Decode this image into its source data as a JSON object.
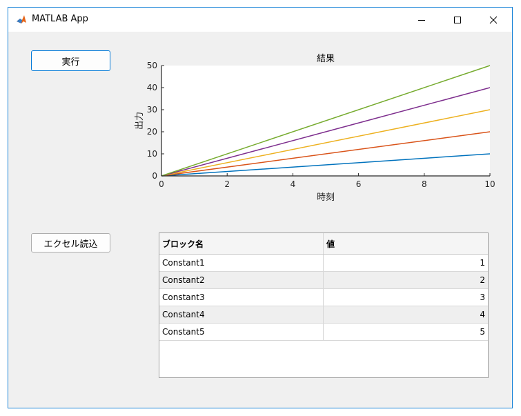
{
  "window": {
    "title": "MATLAB App",
    "controls": {
      "minimize": "—",
      "maximize": "☐",
      "close": "✕"
    }
  },
  "buttons": {
    "run_label": "実行",
    "excel_label": "エクセル読込"
  },
  "chart_data": {
    "type": "line",
    "title": "結果",
    "xlabel": "時刻",
    "ylabel": "出力",
    "xlim": [
      0,
      10
    ],
    "ylim": [
      0,
      50
    ],
    "xticks": [
      0,
      2,
      4,
      6,
      8,
      10
    ],
    "yticks": [
      0,
      10,
      20,
      30,
      40,
      50
    ],
    "grid": false,
    "series": [
      {
        "color": "#0072BD",
        "x": [
          0,
          10
        ],
        "y": [
          0,
          10
        ]
      },
      {
        "color": "#D95319",
        "x": [
          0,
          10
        ],
        "y": [
          0,
          20
        ]
      },
      {
        "color": "#EDB120",
        "x": [
          0,
          10
        ],
        "y": [
          0,
          30
        ]
      },
      {
        "color": "#7E2F8E",
        "x": [
          0,
          10
        ],
        "y": [
          0,
          40
        ]
      },
      {
        "color": "#77AC30",
        "x": [
          0,
          10
        ],
        "y": [
          0,
          50
        ]
      }
    ]
  },
  "table": {
    "headers": [
      "ブロック名",
      "値"
    ],
    "rows": [
      {
        "name": "Constant1",
        "value": "1"
      },
      {
        "name": "Constant2",
        "value": "2"
      },
      {
        "name": "Constant3",
        "value": "3"
      },
      {
        "name": "Constant4",
        "value": "4"
      },
      {
        "name": "Constant5",
        "value": "5"
      }
    ]
  }
}
